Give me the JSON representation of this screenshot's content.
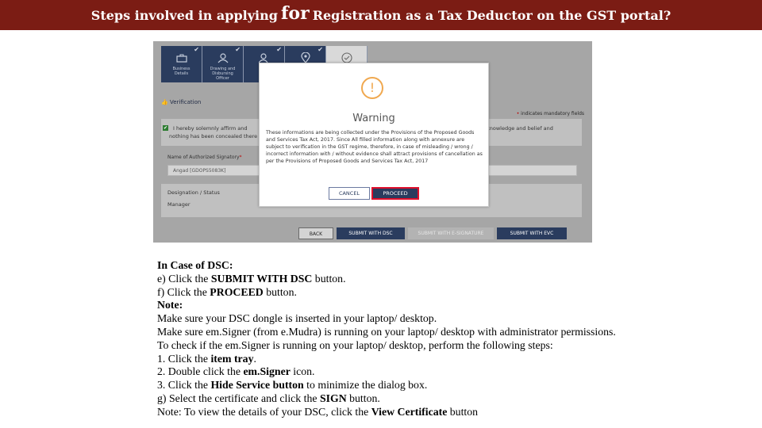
{
  "banner": {
    "title_before": "Steps involved in applying",
    "title_big": "for",
    "title_after": "Registration as a Tax Deductor on the GST portal?"
  },
  "screenshot": {
    "steps": [
      {
        "label_line1": "Business",
        "label_line2": "Details",
        "icon": "briefcase-icon"
      },
      {
        "label_line1": "Drawing and",
        "label_line2": "Disbursing",
        "label_line3": "Officer",
        "icon": "user-icon"
      },
      {
        "label_line1": "Au",
        "label_line2": "S",
        "icon": "user-check-icon"
      },
      {
        "label_line1": "",
        "label_line2": "",
        "icon": "location-icon"
      },
      {
        "label_line1": "",
        "label_line2": "",
        "icon": "check-circle-icon"
      }
    ],
    "verification_label": "Verification",
    "mandatory_note": "indicates mandatory fields",
    "affirm_line1": "I hereby solemnly affirm and",
    "affirm_line2": "nothing has been concealed there",
    "affirm_right": "knowledge and belief and",
    "authorized_signatory_label": "Name of Authorized Signatory",
    "authorized_signatory_value": "Angad [GDOPS5083K]",
    "designation_label": "Designation / Status",
    "designation_value": "Manager",
    "buttons": {
      "back": "BACK",
      "submit_dsc": "SUBMIT WITH DSC",
      "submit_esign": "SUBMIT WITH E-SIGNATURE",
      "submit_evc": "SUBMIT WITH EVC"
    },
    "modal": {
      "title": "Warning",
      "text": "These informations are being collected under the Provisions of the Proposed Goods and Services Tax Act, 2017. Since All filled information along with annexure are subject to verification in the GST regime, therefore, in case of misleading / wrong / incorrect information with / without evidence shall attract provisions of cancellation as per the Provisions of Proposed Goods and Services Tax Act, 2017",
      "cancel": "CANCEL",
      "proceed": "PROCEED"
    }
  },
  "notes": {
    "l1": "In Case of DSC:",
    "l2a": "e) Click the ",
    "l2b": "SUBMIT WITH DSC",
    "l2c": " button.",
    "l3a": "f) Click the ",
    "l3b": "PROCEED",
    "l3c": " button.",
    "l4": "Note:",
    "l5": "Make sure your DSC dongle is inserted in your laptop/ desktop.",
    "l6": "Make sure em.Signer (from e.Mudra) is running on your laptop/ desktop with administrator permissions.",
    "l7": "To check if the em.Signer is running on your laptop/ desktop, perform the following steps:",
    "l8a": "1. Click the ",
    "l8b": "item tray",
    "l8c": ".",
    "l9a": "2. Double click the ",
    "l9b": "em.Signer",
    "l9c": " icon.",
    "l10a": "3. Click the ",
    "l10b": "Hide Service button",
    "l10c": " to minimize the dialog box.",
    "l11a": "g) Select the certificate and click the ",
    "l11b": "SIGN",
    "l11c": " button.",
    "l12a": "Note: To view the details of your DSC, click the ",
    "l12b": "View Certificate",
    "l12c": " button"
  }
}
